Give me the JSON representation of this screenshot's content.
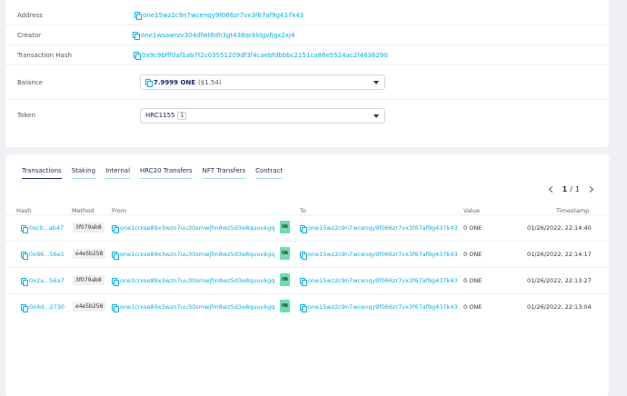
{
  "details": {
    "address": {
      "label": "Address",
      "value": "one15wz2c9n7wcenqy9f066zr7vx3f67af9g437k43"
    },
    "creator": {
      "label": "Creator",
      "value": "one1wsawrzv304dfwt8dh3gt438qckklgvfjgx2xj4"
    },
    "tx_hash": {
      "label": "Transaction Hash",
      "value": "0x9c9bfff0af1ab7f2c03551209df3f4caebfdbbbc2151ca86e5524ac2f4636290"
    },
    "balance": {
      "label": "Balance",
      "amount": "7.9999 ONE",
      "usd": "($1.54)"
    },
    "token": {
      "label": "Token",
      "name": "HRC1155",
      "count": "1"
    }
  },
  "tabs": [
    "Transactions",
    "Staking",
    "Internal",
    "HRC20 Transfers",
    "NFT Transfers",
    "Contract"
  ],
  "pager": {
    "current": "1",
    "separator": "/",
    "total": "1"
  },
  "table": {
    "headers": [
      "Hash",
      "Method",
      "From",
      "To",
      "Value",
      "Timestamp"
    ],
    "rows": [
      {
        "hash": "0xc0...ab47",
        "method": "3f079ab8",
        "from": "one1crxse89x3wzn7uu30smwjfm8wz5d3e8quuvkgq",
        "dir": "IN",
        "to": "one15wz2c9n7wcenqy9f066zr7vx3f67af9g437k43",
        "value": "0 ONE",
        "timestamp": "01/26/2022, 22:14:40"
      },
      {
        "hash": "0x96...56e1",
        "method": "e4e5b258",
        "from": "one1crxse89x3wzn7uu30smwjfm8wz5d3e8quuvkgq",
        "dir": "IN",
        "to": "one15wz2c9n7wcenqy9f066zr7vx3f67af9g437k43",
        "value": "0 ONE",
        "timestamp": "01/26/2022, 22:14:17"
      },
      {
        "hash": "0x2a...56a7",
        "method": "3f079ab8",
        "from": "one1crxse89x3wzn7uu30smwjfm8wz5d3e8quuvkgq",
        "dir": "IN",
        "to": "one15wz2c9n7wcenqy9f066zr7vx3f67af9g437k43",
        "value": "0 ONE",
        "timestamp": "01/26/2022, 22:13:27"
      },
      {
        "hash": "0x4d...2730",
        "method": "e4e5b258",
        "from": "one1crxse89x3wzn7uu30smwjfm8wz5d3e8quuvkgq",
        "dir": "IN",
        "to": "one15wz2c9n7wcenqy9f066zr7vx3f67af9g437k43",
        "value": "0 ONE",
        "timestamp": "01/26/2022, 22:13:04"
      }
    ]
  },
  "colors": {
    "link": "#00aee9",
    "in_badge": "#6fdcae",
    "text": "#1b295e"
  }
}
